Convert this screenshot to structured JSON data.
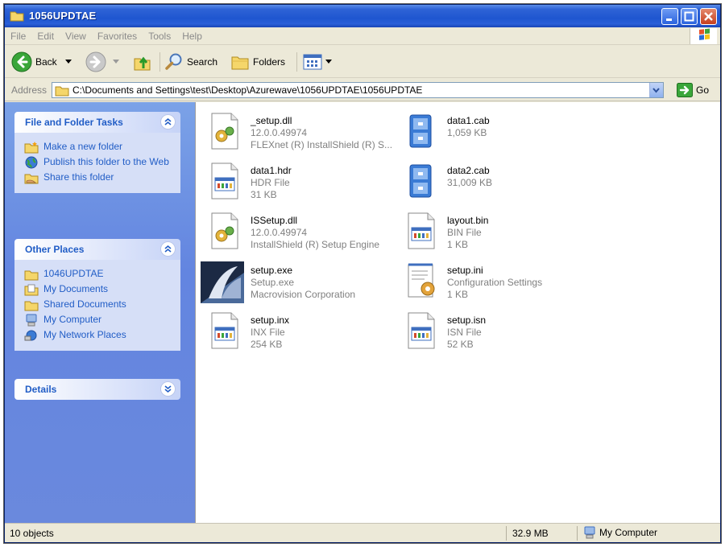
{
  "window": {
    "title": "1056UPDTAE"
  },
  "menu": [
    "File",
    "Edit",
    "View",
    "Favorites",
    "Tools",
    "Help"
  ],
  "toolbar": {
    "back_label": "Back",
    "search_label": "Search",
    "folders_label": "Folders"
  },
  "address": {
    "label": "Address",
    "path": "C:\\Documents and Settings\\test\\Desktop\\Azurewave\\1056UPDTAE\\1056UPDTAE",
    "go_label": "Go"
  },
  "tasks": {
    "title": "File and Folder Tasks",
    "items": [
      "Make a new folder",
      "Publish this folder to the Web",
      "Share this folder"
    ]
  },
  "places": {
    "title": "Other Places",
    "items": [
      "1046UPDTAE",
      "My Documents",
      "Shared Documents",
      "My Computer",
      "My Network Places"
    ]
  },
  "details": {
    "title": "Details"
  },
  "files": [
    {
      "name": "_setup.dll",
      "line1": "12.0.0.49974",
      "line2": "FLEXnet (R) InstallShield (R) S..."
    },
    {
      "name": "data1.cab",
      "line1": "1,059 KB",
      "line2": ""
    },
    {
      "name": "data1.hdr",
      "line1": "HDR File",
      "line2": "31 KB"
    },
    {
      "name": "data2.cab",
      "line1": "31,009 KB",
      "line2": ""
    },
    {
      "name": "ISSetup.dll",
      "line1": "12.0.0.49974",
      "line2": "InstallShield (R) Setup Engine"
    },
    {
      "name": "layout.bin",
      "line1": "BIN File",
      "line2": "1 KB"
    },
    {
      "name": "setup.exe",
      "line1": "Setup.exe",
      "line2": "Macrovision Corporation"
    },
    {
      "name": "setup.ini",
      "line1": "Configuration Settings",
      "line2": "1 KB"
    },
    {
      "name": "setup.inx",
      "line1": "INX File",
      "line2": "254 KB"
    },
    {
      "name": "setup.isn",
      "line1": "ISN File",
      "line2": "52 KB"
    }
  ],
  "status": {
    "objects": "10 objects",
    "size": "32.9 MB",
    "zone": "My Computer"
  }
}
